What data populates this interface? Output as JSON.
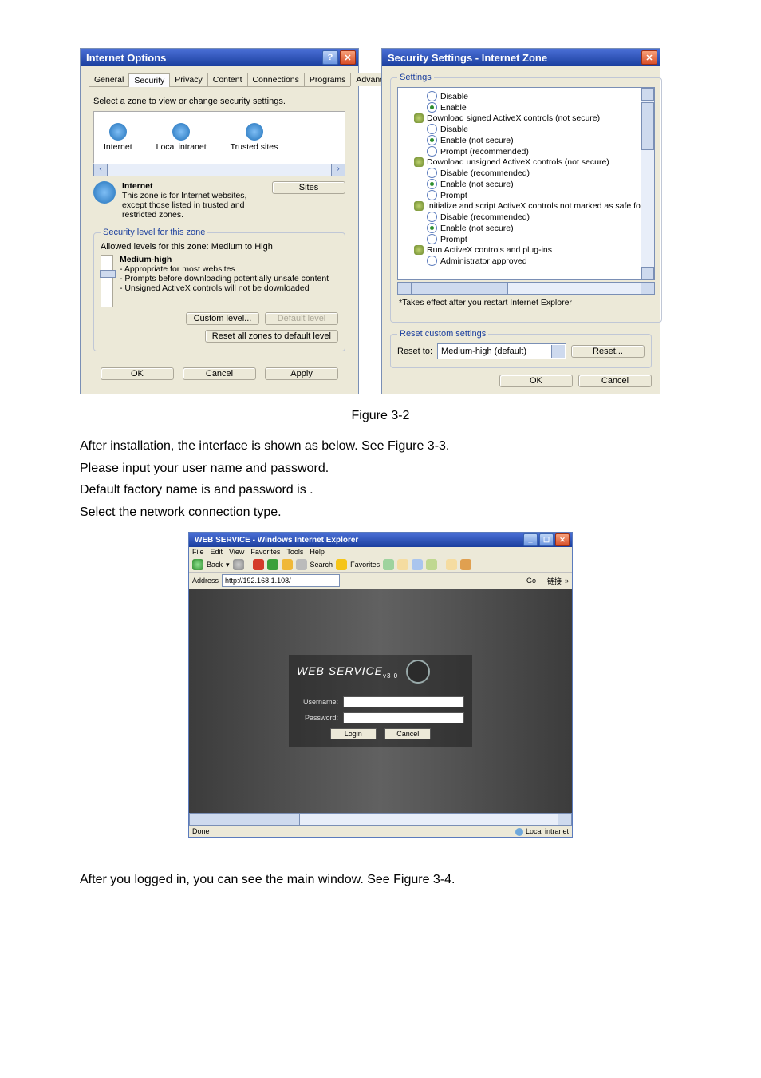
{
  "internet_options": {
    "title": "Internet Options",
    "tabs": [
      "General",
      "Security",
      "Privacy",
      "Content",
      "Connections",
      "Programs",
      "Advanced"
    ],
    "instruction": "Select a zone to view or change security settings.",
    "zones": {
      "internet": "Internet",
      "local": "Local intranet",
      "trusted": "Trusted sites"
    },
    "zone_desc_title": "Internet",
    "zone_desc": "This zone is for Internet websites, except those listed in trusted and restricted zones.",
    "sites_btn": "Sites",
    "sec_legend": "Security level for this zone",
    "allowed": "Allowed levels for this zone: Medium to High",
    "level_name": "Medium-high",
    "level_b1": "- Appropriate for most websites",
    "level_b2": "- Prompts before downloading potentially unsafe content",
    "level_b3": "- Unsigned ActiveX controls will not be downloaded",
    "custom_btn": "Custom level...",
    "default_btn": "Default level",
    "reset_all": "Reset all zones to default level",
    "ok": "OK",
    "cancel": "Cancel",
    "apply": "Apply"
  },
  "security_settings": {
    "title": "Security Settings - Internet Zone",
    "legend": "Settings",
    "items": {
      "g0_o1": "Disable",
      "g0_o2": "Enable",
      "g1": "Download signed ActiveX controls (not secure)",
      "g1_o1": "Disable",
      "g1_o2": "Enable (not secure)",
      "g1_o3": "Prompt (recommended)",
      "g2": "Download unsigned ActiveX controls (not secure)",
      "g2_o1": "Disable (recommended)",
      "g2_o2": "Enable (not secure)",
      "g2_o3": "Prompt",
      "g3": "Initialize and script ActiveX controls not marked as safe for sc",
      "g3_o1": "Disable (recommended)",
      "g3_o2": "Enable (not secure)",
      "g3_o3": "Prompt",
      "g4": "Run ActiveX controls and plug-ins",
      "g4_o1": "Administrator approved"
    },
    "note": "*Takes effect after you restart Internet Explorer",
    "reset_legend": "Reset custom settings",
    "reset_to": "Reset to:",
    "reset_select": "Medium-high (default)",
    "reset_btn": "Reset...",
    "ok": "OK",
    "cancel": "Cancel"
  },
  "caption1": "Figure 3-2",
  "text": {
    "p1": "After installation, the interface is shown as below. See Figure 3-3.",
    "p2": "Please input your user name and password.",
    "p3a": "Default factory name is ",
    "p3b": " and password is ",
    "p3c": ".",
    "p4": "Select the network connection type."
  },
  "web_service": {
    "title": "WEB SERVICE - Windows Internet Explorer",
    "menus": [
      "File",
      "Edit",
      "View",
      "Favorites",
      "Tools",
      "Help"
    ],
    "toolbar_back": "Back",
    "toolbar_search": "Search",
    "toolbar_fav": "Favorites",
    "addr_label": "Address",
    "addr_value": "http://192.168.1.108/",
    "go": "Go",
    "links": "链接",
    "brand": "WEB  SERVICE",
    "ver": "v3.0",
    "username": "Username:",
    "password": "Password:",
    "login": "Login",
    "cancel": "Cancel",
    "status_done": "Done",
    "status_zone": "Local intranet"
  },
  "text2": {
    "p5": "After you logged in, you can see the main window. See Figure 3-4."
  }
}
